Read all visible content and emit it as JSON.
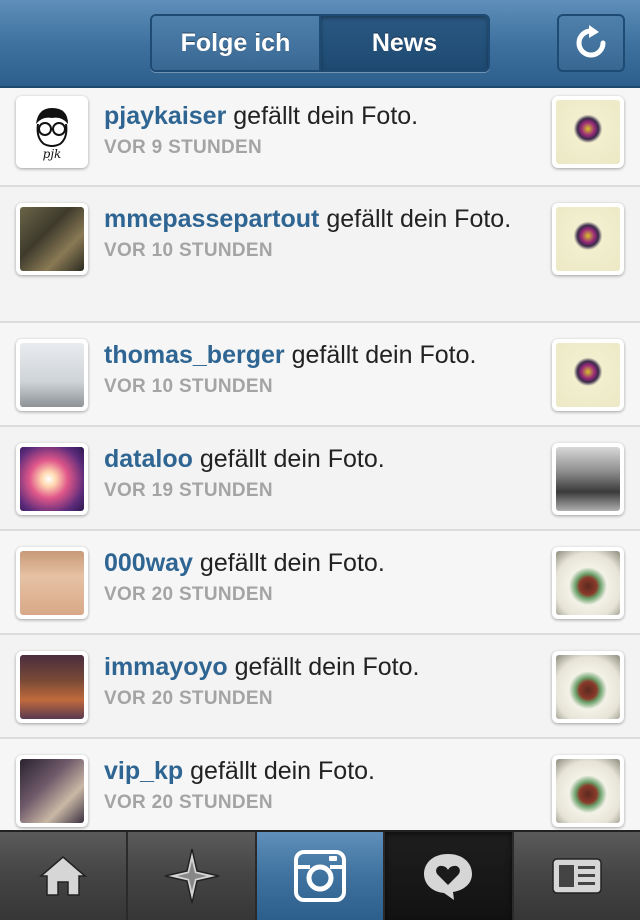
{
  "header": {
    "tabs": [
      {
        "label": "Folge ich",
        "active": false
      },
      {
        "label": "News",
        "active": true
      }
    ],
    "refresh_icon": "refresh-icon"
  },
  "feed": {
    "action_text": "gefällt dein Foto.",
    "items": [
      {
        "user": "pjaykaiser",
        "time": "VOR 9 STUNDEN"
      },
      {
        "user": "mmepassepartout",
        "time": "VOR 10 STUNDEN"
      },
      {
        "user": "thomas_berger",
        "time": "VOR 10 STUNDEN"
      },
      {
        "user": "dataloo",
        "time": "VOR 19 STUNDEN"
      },
      {
        "user": "000way",
        "time": "VOR 20 STUNDEN"
      },
      {
        "user": "immayoyo",
        "time": "VOR 20 STUNDEN"
      },
      {
        "user": "vip_kp",
        "time": "VOR 20 STUNDEN"
      }
    ]
  },
  "avatar_badge": "pjk",
  "tabbar": {
    "items": [
      {
        "icon": "home-icon"
      },
      {
        "icon": "explore-icon"
      },
      {
        "icon": "camera-icon"
      },
      {
        "icon": "news-icon"
      },
      {
        "icon": "profile-icon"
      }
    ]
  },
  "colors": {
    "header_blue": "#3f729f",
    "username_blue": "#2f6592",
    "timestamp_gray": "#a4a4a4"
  }
}
